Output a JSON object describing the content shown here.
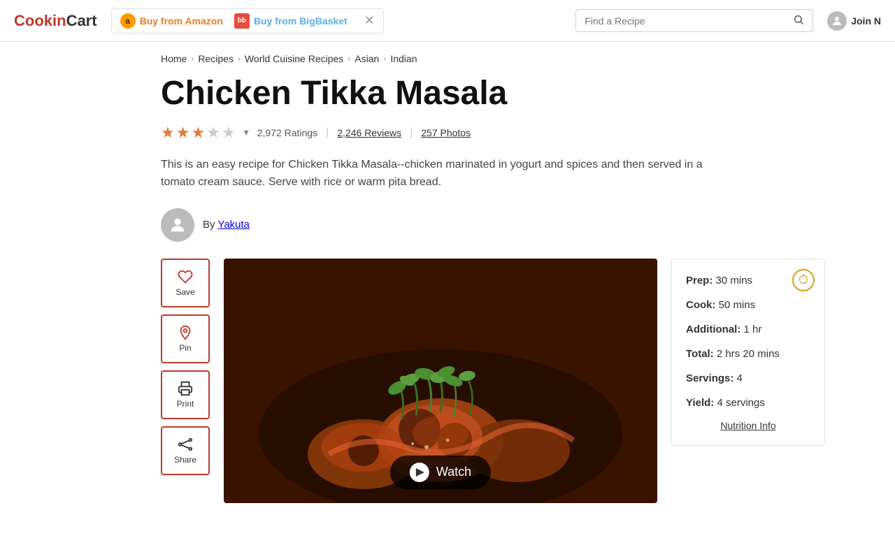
{
  "site": {
    "logo": "CookinCart"
  },
  "header": {
    "buy_amazon_label": "Buy from Amazon",
    "buy_bigbasket_label": "Buy from BigBasket",
    "search_placeholder": "Find a Recipe",
    "join_label": "Join N"
  },
  "breadcrumb": {
    "home": "Home",
    "recipes": "Recipes",
    "world_cuisine": "World Cuisine Recipes",
    "asian": "Asian",
    "indian": "Indian"
  },
  "recipe": {
    "title": "Chicken Tikka Masala",
    "ratings_count": "2,972 Ratings",
    "reviews_count": "2,246 Reviews",
    "photos_count": "257 Photos",
    "description": "This is an easy recipe for Chicken Tikka Masala--chicken marinated in yogurt and spices and then served in a tomato cream sauce. Serve with rice or warm pita bread.",
    "author_by": "By",
    "author_name": "Yakuta"
  },
  "actions": {
    "save": "Save",
    "pin": "Pin",
    "print": "Print",
    "share": "Share"
  },
  "video": {
    "watch_label": "Watch"
  },
  "info": {
    "prep_label": "Prep:",
    "prep_value": "30 mins",
    "cook_label": "Cook:",
    "cook_value": "50 mins",
    "additional_label": "Additional:",
    "additional_value": "1 hr",
    "total_label": "Total:",
    "total_value": "2 hrs 20 mins",
    "servings_label": "Servings:",
    "servings_value": "4",
    "yield_label": "Yield:",
    "yield_value": "4 servings",
    "nutrition_link": "Nutrition Info"
  }
}
